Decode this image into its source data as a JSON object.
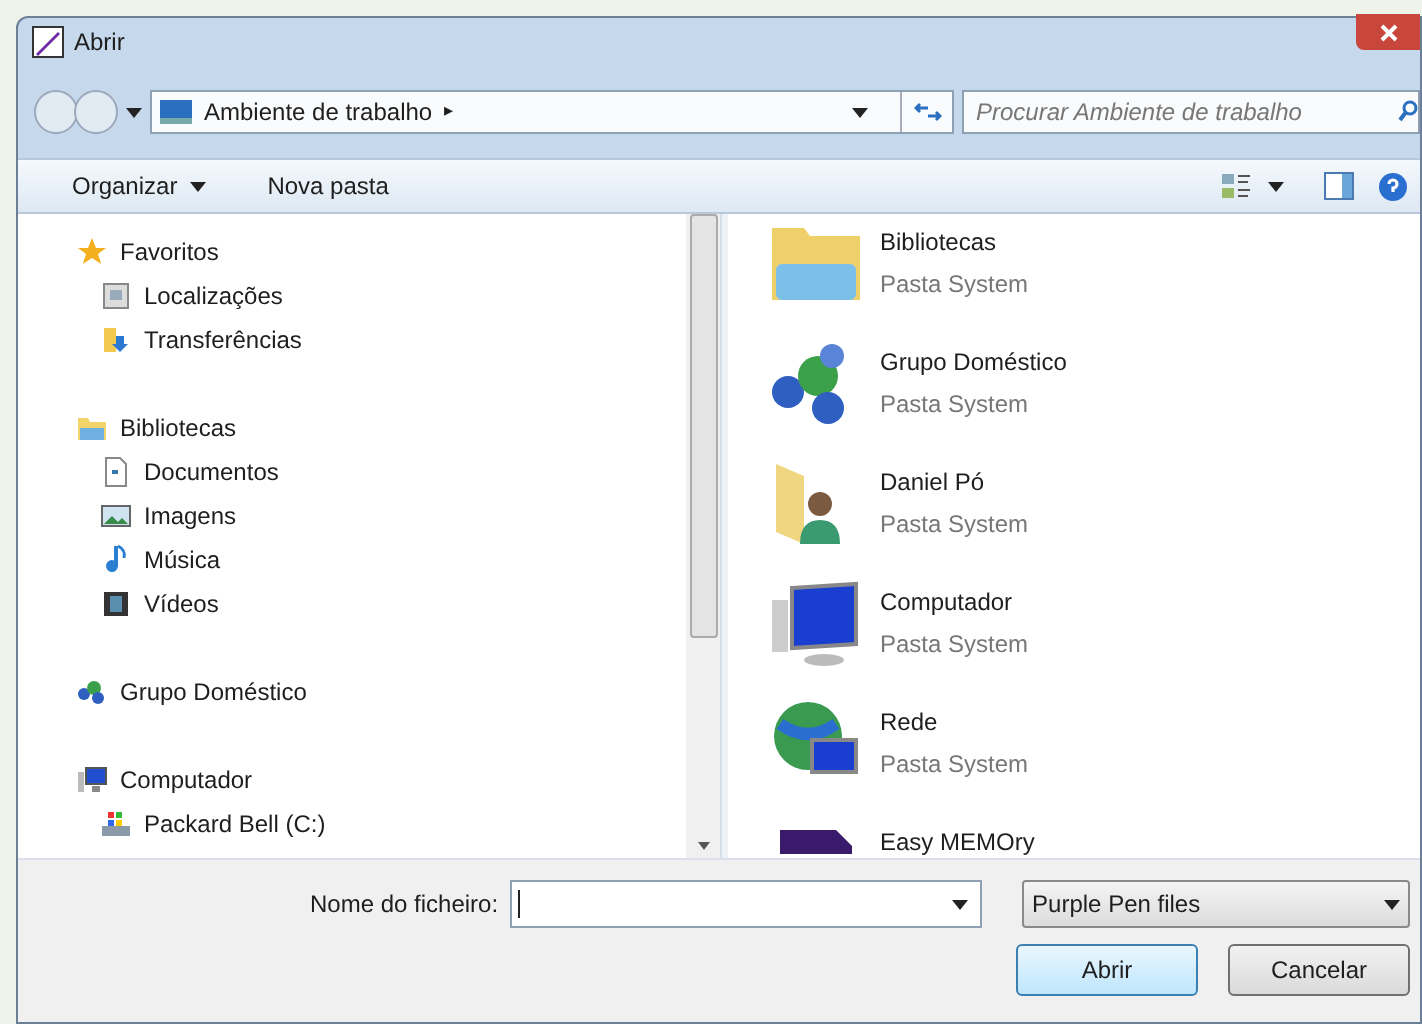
{
  "window": {
    "title": "Abrir"
  },
  "address_bar": {
    "location": "Ambiente de trabalho",
    "separator": "▸"
  },
  "search": {
    "placeholder": "Procurar Ambiente de trabalho"
  },
  "toolbar": {
    "organize": "Organizar",
    "new_folder": "Nova pasta"
  },
  "navigation": [
    {
      "label": "Favoritos",
      "children": [
        {
          "label": "Localizações"
        },
        {
          "label": "Transferências"
        }
      ]
    },
    {
      "label": "Bibliotecas",
      "children": [
        {
          "label": "Documentos"
        },
        {
          "label": "Imagens"
        },
        {
          "label": "Música"
        },
        {
          "label": "Vídeos"
        }
      ]
    },
    {
      "label": "Grupo Doméstico"
    },
    {
      "label": "Computador",
      "children": [
        {
          "label": "Packard Bell (C:)"
        }
      ]
    }
  ],
  "items": [
    {
      "name": "Bibliotecas",
      "type": "Pasta System"
    },
    {
      "name": "Grupo Doméstico",
      "type": "Pasta System"
    },
    {
      "name": "Daniel Pó",
      "type": "Pasta System"
    },
    {
      "name": "Computador",
      "type": "Pasta System"
    },
    {
      "name": "Rede",
      "type": "Pasta System"
    },
    {
      "name": "Easy MEMOry"
    }
  ],
  "file_name": {
    "label": "Nome do ficheiro:"
  },
  "file_type": {
    "value": "Purple Pen files"
  },
  "buttons": [
    {
      "label": "Abrir",
      "default": true
    },
    {
      "label": "Cancelar",
      "default": false
    }
  ]
}
